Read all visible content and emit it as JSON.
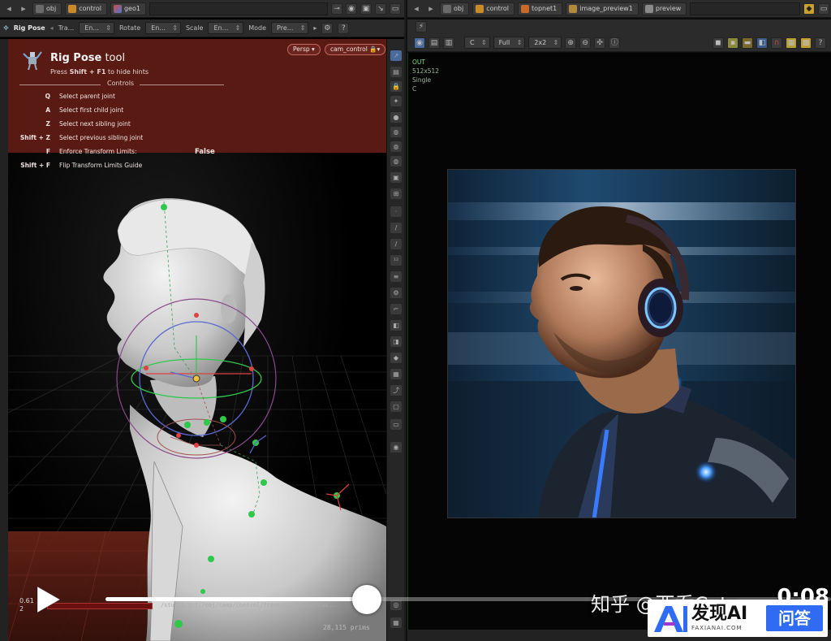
{
  "left_path": {
    "crumbs": [
      {
        "label": "obj",
        "icon": "obj-icon"
      },
      {
        "label": "control",
        "icon": "control-icon"
      },
      {
        "label": "geo1",
        "icon": "geo-icon"
      }
    ]
  },
  "left_toolbar": {
    "tool_name": "Rig Pose",
    "translate_label": "Tra...",
    "translate_value": "En...",
    "rotate_label": "Rotate",
    "rotate_value": "En...",
    "scale_label": "Scale",
    "scale_value": "En...",
    "mode_label": "Mode",
    "mode_value": "Pre..."
  },
  "viewport": {
    "persp_label": "Persp",
    "camera_label": "cam_control"
  },
  "hints": {
    "title_bold": "Rig Pose",
    "title_rest": "tool",
    "subtitle_pre": "Press",
    "subtitle_key": "Shift + F1",
    "subtitle_post": "to hide hints",
    "section": "Controls",
    "rows": [
      {
        "mod": "",
        "key": "Q",
        "desc": "Select parent joint",
        "value": ""
      },
      {
        "mod": "",
        "key": "A",
        "desc": "Select first child joint",
        "value": ""
      },
      {
        "mod": "",
        "key": "Z",
        "desc": "Select next sibling joint",
        "value": ""
      },
      {
        "mod": "Shift",
        "key": "Z",
        "desc": "Select previous sibling joint",
        "value": ""
      },
      {
        "mod": "",
        "key": "F",
        "desc": "Enforce Transform Limits:",
        "value": "False"
      },
      {
        "mod": "Shift",
        "key": "F",
        "desc": "Flip Transform Limits Guide",
        "value": ""
      }
    ]
  },
  "right_path": {
    "crumbs": [
      {
        "label": "obj",
        "icon": "obj-icon"
      },
      {
        "label": "control",
        "icon": "control-icon"
      },
      {
        "label": "topnet1",
        "icon": "topnet-icon"
      },
      {
        "label": "image_preview1",
        "icon": "image-node-icon"
      },
      {
        "label": "preview",
        "icon": "preview-icon"
      }
    ]
  },
  "right_toolbar": {
    "channel": "C",
    "resolution": "Full",
    "grid": "2x2"
  },
  "image_info": {
    "name": "OUT",
    "size": "512x512",
    "mode": "Single",
    "plane": "C"
  },
  "timeline": {
    "value1": "0.61",
    "value2": "2",
    "path": "/studio/git:/obj/camp/control/frame/stable_diffus...",
    "prims_count": "28,115",
    "prims_label": "prims"
  },
  "video": {
    "progress": 0.36,
    "time": "0:08",
    "watermark": "知乎 @西乔Catn"
  },
  "badge": {
    "main": "发现AI",
    "sub": "FAXIANAI.COM",
    "button": "问答"
  },
  "colors": {
    "hint_bg": "#5a1a14",
    "accent_blue": "#2f6cf3"
  }
}
